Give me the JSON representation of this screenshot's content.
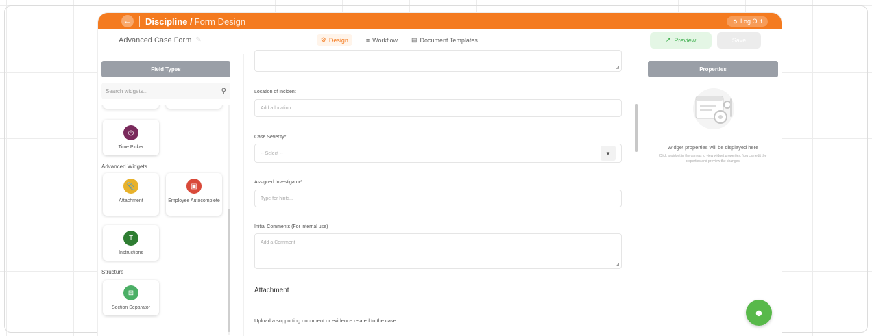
{
  "header": {
    "back_icon": "arrow-left-icon",
    "title_main": "Discipline /",
    "title_sub": "Form Design",
    "logout_label": "Log Out",
    "accent_color": "#f47b20"
  },
  "subbar": {
    "form_name": "Advanced Case Form",
    "tabs": [
      {
        "label": "Design",
        "icon": "gear-icon",
        "active": true
      },
      {
        "label": "Workflow",
        "icon": "workflow-icon",
        "active": false
      },
      {
        "label": "Document Templates",
        "icon": "document-icon",
        "active": false
      }
    ],
    "preview_label": "Preview",
    "save_label": "Save"
  },
  "left_panel": {
    "header": "Field Types",
    "search_placeholder": "Search widgets...",
    "widgets_top": [
      {
        "label": "Time Picker",
        "icon": "clock-icon",
        "color": "#7a2a5c"
      }
    ],
    "advanced_label": "Advanced Widgets",
    "advanced_widgets": [
      {
        "label": "Attachment",
        "icon": "paperclip-icon",
        "color": "#e8b22c"
      },
      {
        "label": "Employee Autocomplete",
        "icon": "scan-user-icon",
        "color": "#d94a3a"
      },
      {
        "label": "Instructions",
        "icon": "text-icon",
        "color": "#2e7d32"
      }
    ],
    "structure_label": "Structure",
    "structure_widgets": [
      {
        "label": "Section Separator",
        "icon": "separator-icon",
        "color": "#4caf66"
      }
    ]
  },
  "form": {
    "location_label": "Location of Incident",
    "location_placeholder": "Add a location",
    "severity_label": "Case Severity*",
    "severity_value": "-- Select --",
    "investigator_label": "Assigned Investigator*",
    "investigator_placeholder": "Type for hints...",
    "comments_label": "Initial Comments (For internal use)",
    "comments_placeholder": "Add a Comment",
    "attachment_section": "Attachment",
    "attachment_desc": "Upload a supporting document or evidence related to the case."
  },
  "right_panel": {
    "header": "Properties",
    "empty_title": "Widget properties will be displayed here",
    "empty_desc": "Click a widget in the canvas to view widget properties. You can edit the properties and preview the changes."
  }
}
